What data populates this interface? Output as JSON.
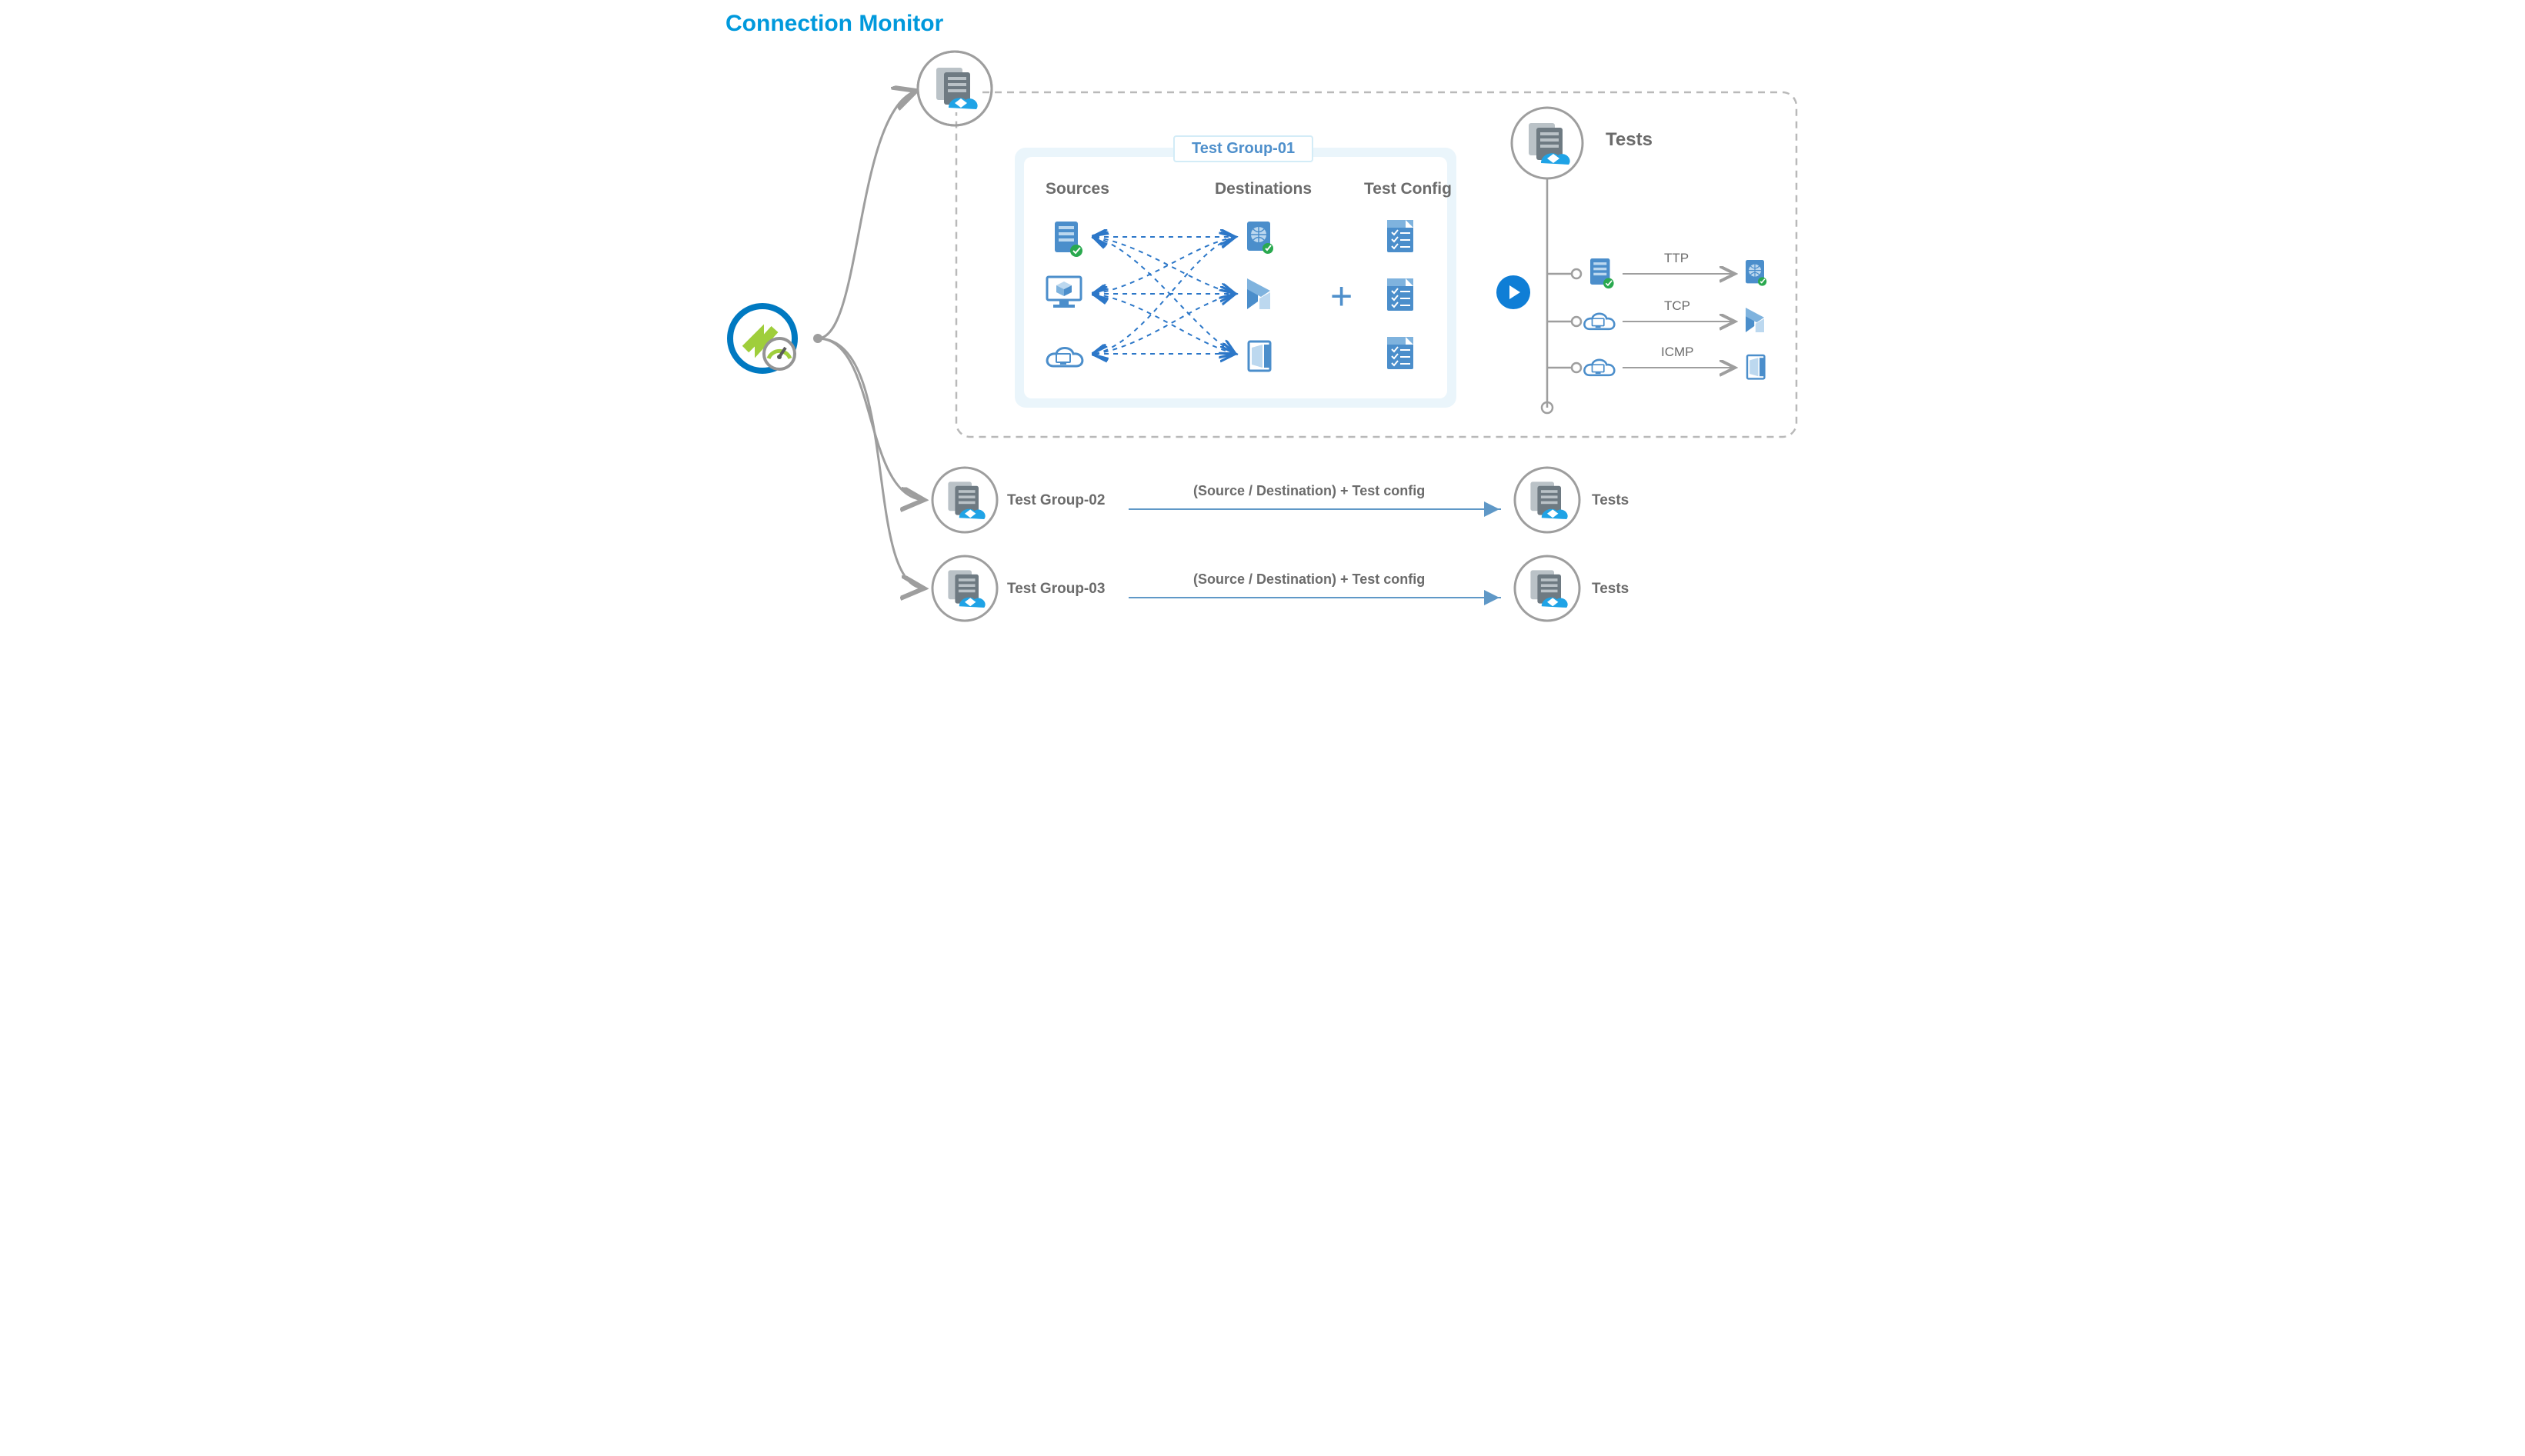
{
  "title": "Connection Monitor",
  "group1": {
    "title": "Test Group-01",
    "col_sources": "Sources",
    "col_destinations": "Destinations",
    "col_testconfig": "Test Config"
  },
  "tests_label": "Tests",
  "protocols": {
    "p1": "TTP",
    "p2": "TCP",
    "p3": "ICMP"
  },
  "group2": {
    "label": "Test Group-02",
    "note": "(Source / Destination) + Test config",
    "out": "Tests"
  },
  "group3": {
    "label": "Test Group-03",
    "note": "(Source / Destination) + Test config",
    "out": "Tests"
  }
}
